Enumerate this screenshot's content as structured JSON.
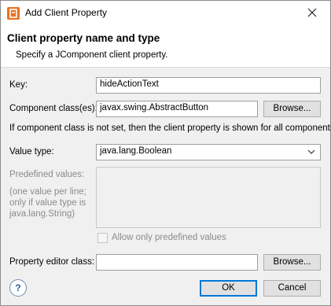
{
  "window": {
    "title": "Add Client Property"
  },
  "header": {
    "title": "Client property name and type",
    "subtitle": "Specify a JComponent client property."
  },
  "form": {
    "key_label": "Key:",
    "key_value": "hideActionText",
    "component_label": "Component class(es):",
    "component_value": "javax.swing.AbstractButton",
    "browse_label": "Browse...",
    "component_hint": "If component class is not set, then the client property is shown for all components.",
    "value_type_label": "Value type:",
    "value_type_value": "java.lang.Boolean",
    "predefined_label": "Predefined values:",
    "predefined_note_1": "(one value per line;",
    "predefined_note_2": "only if value type is",
    "predefined_note_3": "java.lang.String)",
    "only_predefined_label": "Allow only predefined values",
    "only_predefined_checked": false,
    "editor_label": "Property editor class:",
    "editor_value": "",
    "editor_browse_label": "Browse..."
  },
  "footer": {
    "ok_label": "OK",
    "cancel_label": "Cancel",
    "help_label": "?"
  },
  "colors": {
    "accent": "#0078d7",
    "app_icon": "#e8731f"
  },
  "icons": {
    "app": "app-logo-icon",
    "close": "close-icon",
    "dropdown": "chevron-down-icon",
    "help": "help-icon"
  }
}
